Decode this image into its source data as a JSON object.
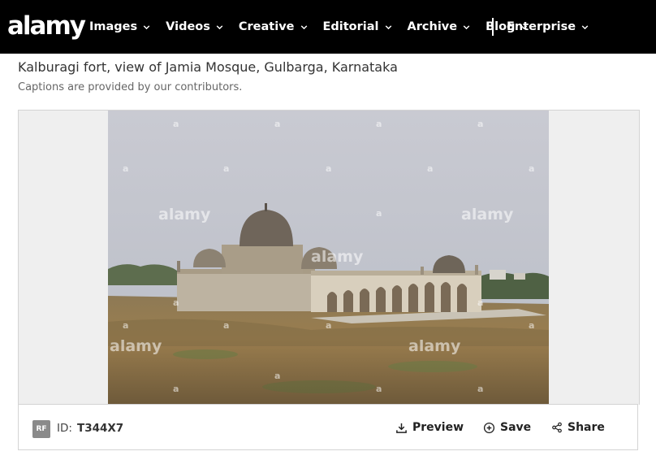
{
  "header": {
    "logo": "alamy",
    "nav": [
      {
        "label": "Images"
      },
      {
        "label": "Videos"
      },
      {
        "label": "Creative"
      },
      {
        "label": "Editorial"
      },
      {
        "label": "Archive"
      },
      {
        "label": "Blog"
      },
      {
        "label": "Enterprise"
      }
    ]
  },
  "image": {
    "title": "Kalburagi fort, view of Jamia Mosque, Gulbarga, Karnataka",
    "caption_note": "Captions are provided by our contributors.",
    "watermark": "alamy",
    "watermark_small": "a",
    "license_badge": "RF",
    "id_label": "ID:",
    "id_value": "T344X7"
  },
  "actions": {
    "preview": "Preview",
    "save": "Save",
    "share": "Share"
  },
  "colors": {
    "topbar": "#000000",
    "frame_bg": "#efefef",
    "badge": "#8a8a8a"
  }
}
